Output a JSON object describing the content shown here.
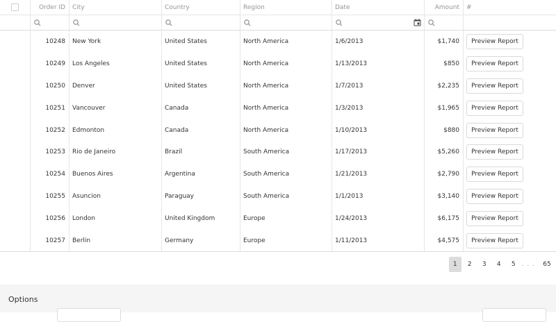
{
  "header": {
    "order_id": "Order ID",
    "city": "City",
    "country": "Country",
    "region": "Region",
    "date": "Date",
    "amount": "Amount",
    "actions": "#"
  },
  "rows": [
    {
      "order_id": "10248",
      "city": "New York",
      "country": "United States",
      "region": "North America",
      "date": "1/6/2013",
      "amount": "$1,740",
      "action": "Preview Report"
    },
    {
      "order_id": "10249",
      "city": "Los Angeles",
      "country": "United States",
      "region": "North America",
      "date": "1/13/2013",
      "amount": "$850",
      "action": "Preview Report"
    },
    {
      "order_id": "10250",
      "city": "Denver",
      "country": "United States",
      "region": "North America",
      "date": "1/7/2013",
      "amount": "$2,235",
      "action": "Preview Report"
    },
    {
      "order_id": "10251",
      "city": "Vancouver",
      "country": "Canada",
      "region": "North America",
      "date": "1/3/2013",
      "amount": "$1,965",
      "action": "Preview Report"
    },
    {
      "order_id": "10252",
      "city": "Edmonton",
      "country": "Canada",
      "region": "North America",
      "date": "1/10/2013",
      "amount": "$880",
      "action": "Preview Report"
    },
    {
      "order_id": "10253",
      "city": "Rio de Janeiro",
      "country": "Brazil",
      "region": "South America",
      "date": "1/17/2013",
      "amount": "$5,260",
      "action": "Preview Report"
    },
    {
      "order_id": "10254",
      "city": "Buenos Aires",
      "country": "Argentina",
      "region": "South America",
      "date": "1/21/2013",
      "amount": "$2,790",
      "action": "Preview Report"
    },
    {
      "order_id": "10255",
      "city": "Asuncion",
      "country": "Paraguay",
      "region": "South America",
      "date": "1/1/2013",
      "amount": "$3,140",
      "action": "Preview Report"
    },
    {
      "order_id": "10256",
      "city": "London",
      "country": "United Kingdom",
      "region": "Europe",
      "date": "1/24/2013",
      "amount": "$6,175",
      "action": "Preview Report"
    },
    {
      "order_id": "10257",
      "city": "Berlin",
      "country": "Germany",
      "region": "Europe",
      "date": "1/11/2013",
      "amount": "$4,575",
      "action": "Preview Report"
    }
  ],
  "pager": {
    "pages": [
      "1",
      "2",
      "3",
      "4",
      "5"
    ],
    "current": "1",
    "ellipsis": ". . .",
    "last": "65"
  },
  "options": {
    "title": "Options"
  },
  "icons": {
    "filter": "search-icon",
    "date_picker": "calendar-icon"
  },
  "colors": {
    "active_page": "#dcdcdc",
    "options_bg": "#f5f5f5"
  }
}
